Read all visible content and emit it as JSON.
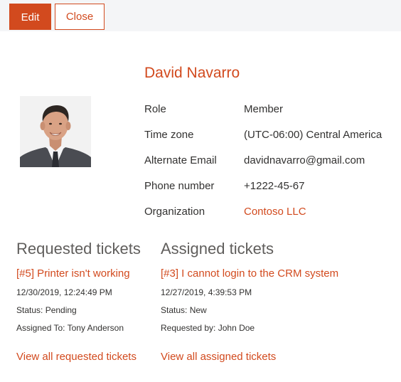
{
  "toolbar": {
    "edit_label": "Edit",
    "close_label": "Close"
  },
  "contact": {
    "name": "David Navarro",
    "properties": [
      {
        "label": "Role",
        "value": "Member",
        "is_link": false
      },
      {
        "label": "Time zone",
        "value": "(UTC-06:00) Central America",
        "is_link": false
      },
      {
        "label": "Alternate Email",
        "value": "davidnavarro@gmail.com",
        "is_link": false
      },
      {
        "label": "Phone number",
        "value": "+1222-45-67",
        "is_link": false
      },
      {
        "label": "Organization",
        "value": "Contoso LLC",
        "is_link": true
      }
    ]
  },
  "requested": {
    "title": "Requested tickets",
    "ticket_title": "[#5] Printer isn't working",
    "date": "12/30/2019, 12:24:49 PM",
    "status": "Status: Pending",
    "person": "Assigned To: Tony Anderson",
    "view_all": "View all requested tickets"
  },
  "assigned": {
    "title": "Assigned tickets",
    "ticket_title": "[#3] I cannot login to the CRM system",
    "date": "12/27/2019, 4:39:53 PM",
    "status": "Status: New",
    "person": "Requested by: John Doe",
    "view_all": "View all assigned tickets"
  },
  "colors": {
    "accent": "#d24a1e",
    "text": "#323130",
    "muted": "#605e5c",
    "toolbar_bg": "#f4f5f7"
  },
  "icons": {
    "avatar": "person-photo"
  }
}
